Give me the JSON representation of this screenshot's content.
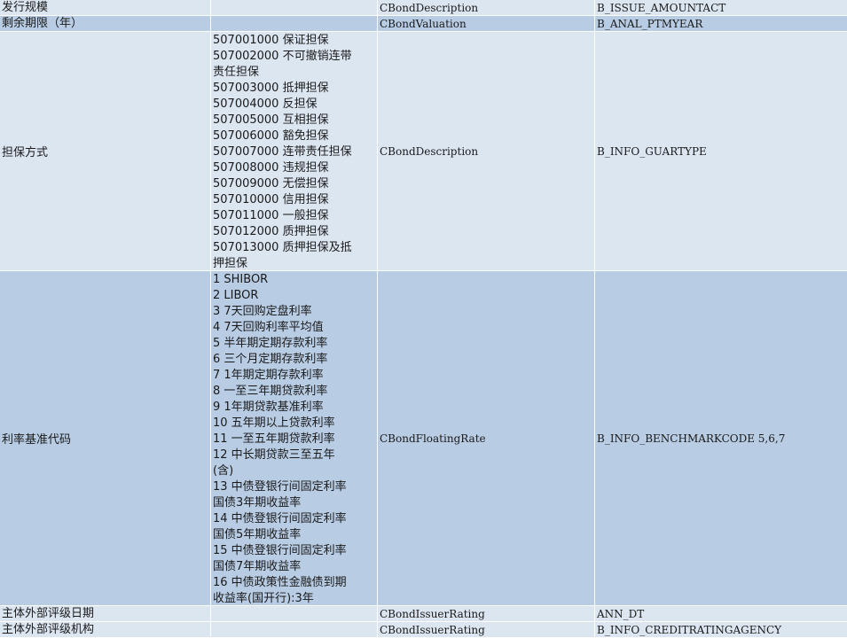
{
  "rows": [
    {
      "field": "发行规模",
      "values": [],
      "source": "CBondDescription",
      "column": "B_ISSUE_AMOUNTACT"
    },
    {
      "field": "剩余期限（年）",
      "values": [],
      "source": "CBondValuation",
      "column": "B_ANAL_PTMYEAR"
    },
    {
      "field": "担保方式",
      "values": [
        "507001000 保证担保",
        "507002000 不可撤销连带",
        "责任担保",
        "507003000 抵押担保",
        "507004000 反担保",
        "507005000 互相担保",
        "507006000 豁免担保",
        "507007000 连带责任担保",
        "507008000 违规担保",
        "507009000 无偿担保",
        "507010000 信用担保",
        "507011000 一般担保",
        "507012000 质押担保",
        "507013000 质押担保及抵",
        "押担保"
      ],
      "source": "CBondDescription",
      "column": "B_INFO_GUARTYPE"
    },
    {
      "field": "利率基准代码",
      "values": [
        "1 SHIBOR",
        "2 LIBOR",
        "3 7天回购定盘利率",
        "4 7天回购利率平均值",
        "5 半年期定期存款利率",
        "6 三个月定期存款利率",
        "7 1年期定期存款利率",
        "8 一至三年期贷款利率",
        "9 1年期贷款基准利率",
        "10 五年期以上贷款利率",
        "11 一至五年期贷款利率",
        "12 中长期贷款三至五年",
        "(含)",
        "13 中债登银行间固定利率",
        "国债3年期收益率",
        "14 中债登银行间固定利率",
        "国债5年期收益率",
        "15 中债登银行间固定利率",
        "国债7年期收益率",
        "16 中债政策性金融债到期",
        "收益率(国开行):3年"
      ],
      "source": "CBondFloatingRate",
      "column": "B_INFO_BENCHMARKCODE 5,6,7"
    },
    {
      "field": "主体外部评级日期",
      "values": [],
      "source": "CBondIssuerRating",
      "column": "ANN_DT"
    },
    {
      "field": "主体外部评级机构",
      "values": [],
      "source": "CBondIssuerRating",
      "column": "B_INFO_CREDITRATINGAGENCY"
    }
  ]
}
